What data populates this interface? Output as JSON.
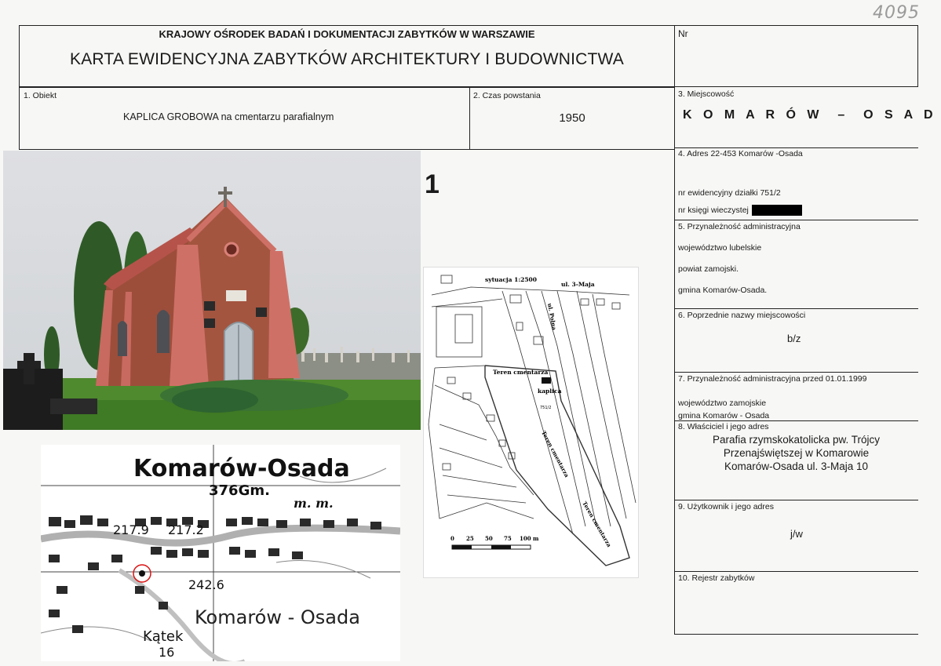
{
  "corner_number": "4095",
  "header": {
    "institution": "KRAJOWY OŚRODEK BADAŃ I DOKUMENTACJI ZABYTKÓW W WARSZAWIE",
    "title": "KARTA EWIDENCYJNA ZABYTKÓW ARCHITEKTURY I BUDOWNICTWA",
    "nr_label": "Nr"
  },
  "fields": {
    "obiekt_label": "1. Obiekt",
    "obiekt_value": "KAPLICA GROBOWA na cmentarzu parafialnym",
    "czas_label": "2. Czas powstania",
    "czas_value": "1950",
    "miejscowosc_label": "3. Miejscowość",
    "miejscowosc_value": "K O M A R Ó W  –  O S A D A",
    "adres_label": "4. Adres  22-453 Komarów -Osada",
    "dzialka": "nr ewidencyjny działki 751/2",
    "ksiega": "nr księgi wieczystej",
    "przynaleznosc_label": "5. Przynależność administracyjna",
    "wojewodztwo": "województwo lubelskie",
    "powiat": "powiat  zamojski.",
    "gmina": "gmina Komarów-Osada.",
    "poprzednie_label": "6. Poprzednie nazwy miejscowości",
    "poprzednie_value": "b/z",
    "przed1999_label": "7. Przynależność administracyjna przed 01.01.1999",
    "przed1999_woj": "województwo  zamojskie",
    "przed1999_gmina": "gmina Komarów - Osada",
    "wlasciciel_label": "8. Właściciel i jego adres",
    "wlasciciel_line1": "Parafia rzymskokatolicka pw. Trójcy",
    "wlasciciel_line2": "Przenajświętszej w Komarowie",
    "wlasciciel_line3": "Komarów-Osada ul. 3-Maja 10",
    "uzytkownik_label": "9. Użytkownik i jego adres",
    "uzytkownik_value": "j/w",
    "rejestr_label": "10. Rejestr zabytków"
  },
  "plate_number": "1",
  "situation_map": {
    "title": "sytuacja 1:2500",
    "street_top": "ul. 3-Maja",
    "street_polna": "ul. Polna",
    "cemetery": "Teren cmentarza",
    "chapel": "kaplica",
    "parcel": "751/2",
    "cemetery_2": "Teren cmentarza",
    "cemetery_3": "Teren cmentarza",
    "scale_labels": [
      "0",
      "25",
      "50",
      "75",
      "100 m"
    ]
  },
  "topo_map": {
    "name_top": "Komarów-Osada",
    "elev_1": "376Gm.",
    "mm": "m. m.",
    "h1": "217.9",
    "h2": "217.2",
    "h3": "242.6",
    "name_bottom": "Komarów - Osada",
    "katek": "Kątek",
    "n16": "16"
  }
}
